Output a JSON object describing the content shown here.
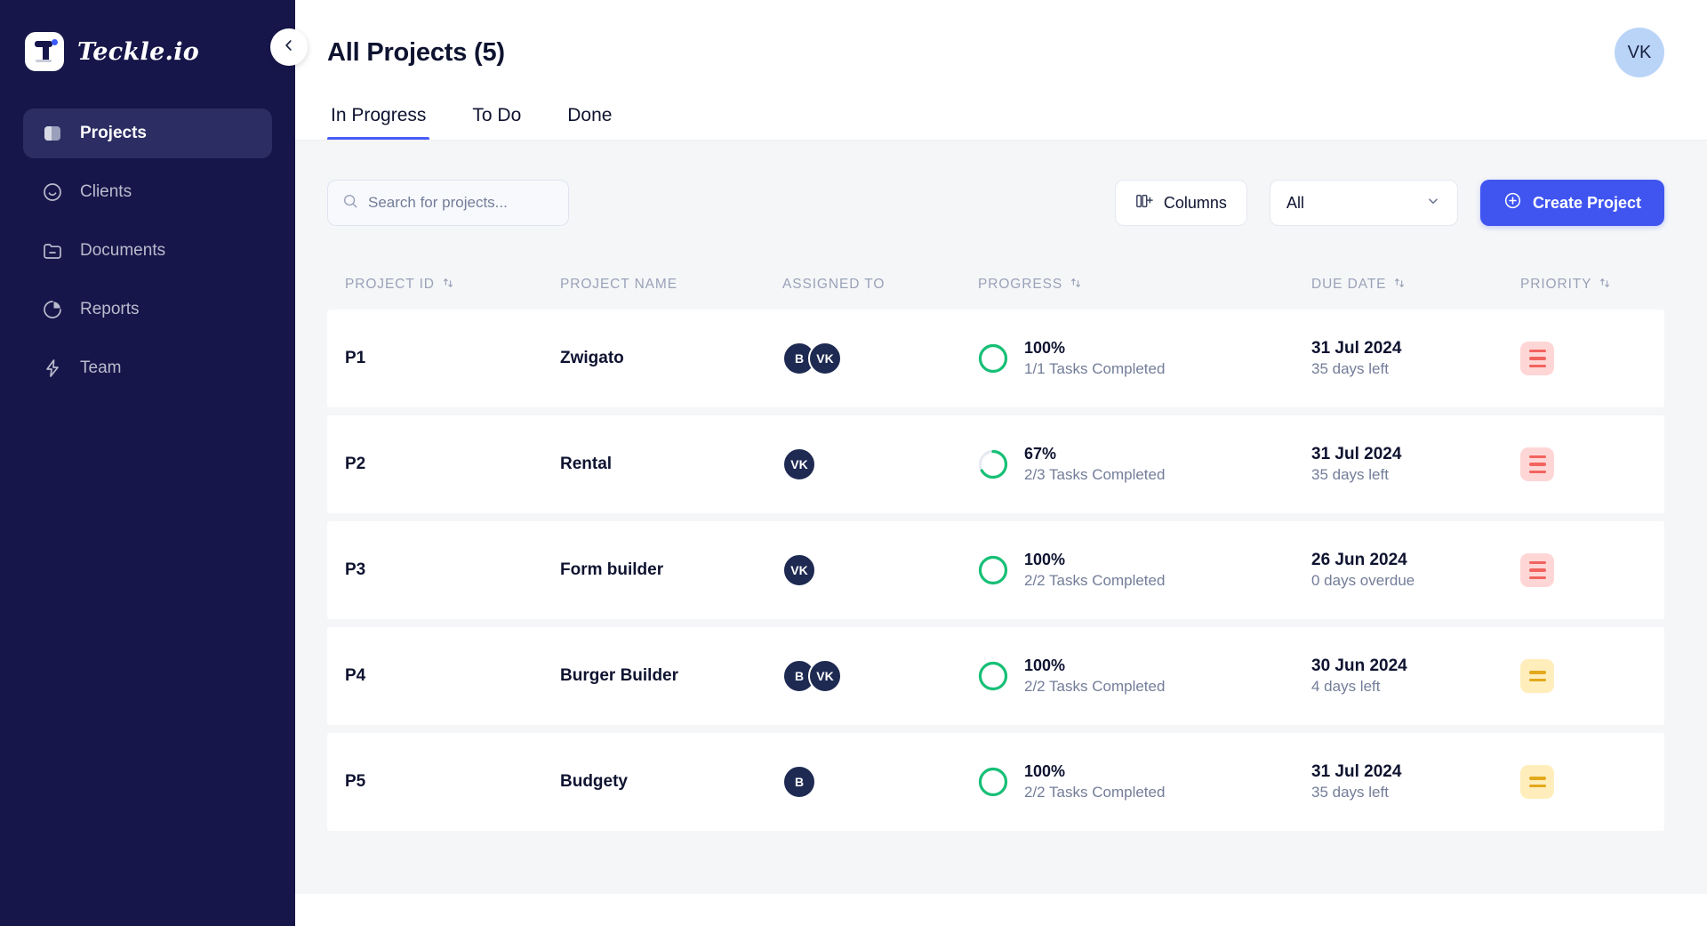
{
  "brand": {
    "name": "Teckle.io",
    "logo_icon": "teckle-logo-icon"
  },
  "sidebar": {
    "items": [
      {
        "label": "Projects",
        "icon": "projects-icon",
        "active": true
      },
      {
        "label": "Clients",
        "icon": "smiley-face-icon",
        "active": false
      },
      {
        "label": "Documents",
        "icon": "folder-icon",
        "active": false
      },
      {
        "label": "Reports",
        "icon": "pie-chart-icon",
        "active": false
      },
      {
        "label": "Team",
        "icon": "lightning-bolt-icon",
        "active": false
      }
    ]
  },
  "header": {
    "title": "All Projects (5)",
    "avatar_initials": "VK",
    "collapse_icon": "chevron-left-icon"
  },
  "tabs": [
    {
      "label": "In Progress",
      "active": true
    },
    {
      "label": "To Do",
      "active": false
    },
    {
      "label": "Done",
      "active": false
    }
  ],
  "toolbar": {
    "search": {
      "placeholder": "Search for projects...",
      "value": "",
      "icon": "search-icon"
    },
    "columns_label": "Columns",
    "columns_icon": "columns-icon",
    "filter_value": "All",
    "filter_icon": "chevron-down-icon",
    "create_label": "Create Project",
    "create_icon": "plus-circle-icon"
  },
  "table": {
    "columns": [
      {
        "label": "Project ID",
        "sortable": true
      },
      {
        "label": "Project Name",
        "sortable": false
      },
      {
        "label": "Assigned To",
        "sortable": false
      },
      {
        "label": "Progress",
        "sortable": true
      },
      {
        "label": "Due Date",
        "sortable": true
      },
      {
        "label": "Priority",
        "sortable": true
      }
    ],
    "sort_icon": "sort-arrows-icon",
    "rows": [
      {
        "id": "P1",
        "name": "Zwigato",
        "assignees": [
          "B",
          "VK"
        ],
        "progress_pct": "100%",
        "progress_value": 100,
        "tasks": "1/1 Tasks Completed",
        "due_date": "31 Jul 2024",
        "due_sub": "35 days left",
        "priority": "high"
      },
      {
        "id": "P2",
        "name": "Rental",
        "assignees": [
          "VK"
        ],
        "progress_pct": "67%",
        "progress_value": 67,
        "tasks": "2/3 Tasks Completed",
        "due_date": "31 Jul 2024",
        "due_sub": "35 days left",
        "priority": "high"
      },
      {
        "id": "P3",
        "name": "Form builder",
        "assignees": [
          "VK"
        ],
        "progress_pct": "100%",
        "progress_value": 100,
        "tasks": "2/2 Tasks Completed",
        "due_date": "26 Jun 2024",
        "due_sub": "0 days overdue",
        "priority": "high"
      },
      {
        "id": "P4",
        "name": "Burger Builder",
        "assignees": [
          "B",
          "VK"
        ],
        "progress_pct": "100%",
        "progress_value": 100,
        "tasks": "2/2 Tasks Completed",
        "due_date": "30 Jun 2024",
        "due_sub": "4 days left",
        "priority": "medium"
      },
      {
        "id": "P5",
        "name": "Budgety",
        "assignees": [
          "B"
        ],
        "progress_pct": "100%",
        "progress_value": 100,
        "tasks": "2/2 Tasks Completed",
        "due_date": "31 Jul 2024",
        "due_sub": "35 days left",
        "priority": "medium"
      }
    ]
  },
  "colors": {
    "sidebar_bg": "#16164a",
    "sidebar_active": "#2b2d63",
    "accent": "#4055f0",
    "tab_underline": "#4a5cf5",
    "progress_green": "#17c076",
    "progress_track": "#e7eaf0",
    "priority_high_bg": "#ffd6d6",
    "priority_high_fg": "#f2635f",
    "priority_medium_bg": "#ffeebb",
    "priority_medium_fg": "#e3a81c",
    "page_bg": "#f5f6f8",
    "row_bg": "#ffffff",
    "avatar_bg": "#1e2a52",
    "top_avatar_bg": "#bad4f8"
  }
}
